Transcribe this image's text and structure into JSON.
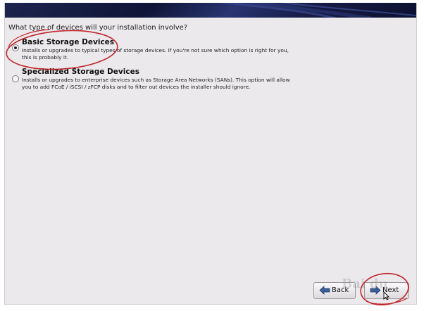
{
  "question": "What type of devices will your installation involve?",
  "options": [
    {
      "title": "Basic Storage Devices",
      "desc_line1": "Installs or upgrades to typical types of storage devices.  If you're not sure which option is right for you,",
      "desc_line2": "this is probably it.",
      "selected": true
    },
    {
      "title": "Specialized Storage Devices",
      "desc_line1": "Installs or upgrades to enterprise devices such as Storage Area Networks (SANs). This option will allow",
      "desc_line2": "you to add FCoE / iSCSI / zFCP disks and to filter out devices the installer should ignore.",
      "selected": false
    }
  ],
  "buttons": {
    "back": "Back",
    "next": "Next"
  },
  "icons": {
    "back": "arrow-left-icon",
    "next": "arrow-right-icon"
  },
  "colors": {
    "banner": "#151b43",
    "annotation": "#c0262c",
    "arrow_icon": "#3b5f9a"
  },
  "watermark": "Bai du"
}
